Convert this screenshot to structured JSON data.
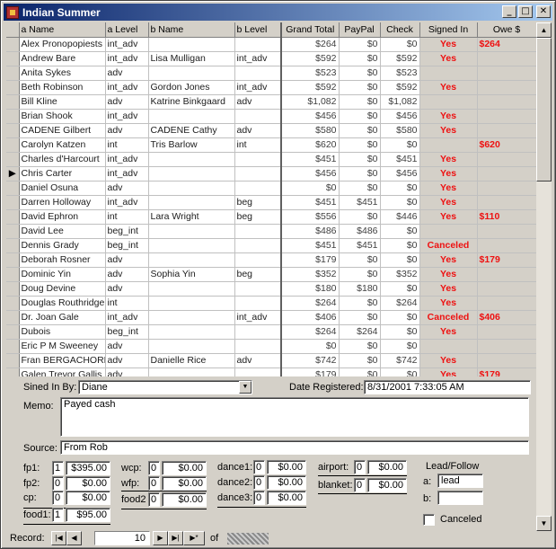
{
  "window": {
    "title": "Indian Summer"
  },
  "grid": {
    "headers": [
      "a Name",
      "a Level",
      "b Name",
      "b Level",
      "Grand Total",
      "PayPal",
      "Check",
      "Signed In",
      "Owe $"
    ],
    "rows": [
      {
        "a_name": "Alex Pronopopiests",
        "a_level": "int_adv",
        "b_name": "",
        "b_level": "",
        "grand_total": "$264",
        "paypal": "$0",
        "check": "$0",
        "signed": "Yes",
        "owe": "$264"
      },
      {
        "a_name": "Andrew Bare",
        "a_level": "int_adv",
        "b_name": "Lisa Mulligan",
        "b_level": "int_adv",
        "grand_total": "$592",
        "paypal": "$0",
        "check": "$592",
        "signed": "Yes",
        "owe": ""
      },
      {
        "a_name": "Anita Sykes",
        "a_level": "adv",
        "b_name": "",
        "b_level": "",
        "grand_total": "$523",
        "paypal": "$0",
        "check": "$523",
        "signed": "",
        "owe": ""
      },
      {
        "a_name": "Beth Robinson",
        "a_level": "int_adv",
        "b_name": "Gordon Jones",
        "b_level": "int_adv",
        "grand_total": "$592",
        "paypal": "$0",
        "check": "$592",
        "signed": "Yes",
        "owe": ""
      },
      {
        "a_name": "Bill Kline",
        "a_level": "adv",
        "b_name": "Katrine Binkgaard",
        "b_level": "adv",
        "grand_total": "$1,082",
        "paypal": "$0",
        "check": "$1,082",
        "signed": "",
        "owe": ""
      },
      {
        "a_name": "Brian Shook",
        "a_level": "int_adv",
        "b_name": "",
        "b_level": "",
        "grand_total": "$456",
        "paypal": "$0",
        "check": "$456",
        "signed": "Yes",
        "owe": ""
      },
      {
        "a_name": "CADENE Gilbert",
        "a_level": "adv",
        "b_name": "CADENE Cathy",
        "b_level": "adv",
        "grand_total": "$580",
        "paypal": "$0",
        "check": "$580",
        "signed": "Yes",
        "owe": ""
      },
      {
        "a_name": "Carolyn Katzen",
        "a_level": "int",
        "b_name": "Tris Barlow",
        "b_level": "int",
        "grand_total": "$620",
        "paypal": "$0",
        "check": "$0",
        "signed": "",
        "owe": "$620"
      },
      {
        "a_name": "Charles d'Harcourt",
        "a_level": "int_adv",
        "b_name": "",
        "b_level": "",
        "grand_total": "$451",
        "paypal": "$0",
        "check": "$451",
        "signed": "Yes",
        "owe": ""
      },
      {
        "a_name": "Chris Carter",
        "a_level": "int_adv",
        "b_name": "",
        "b_level": "",
        "grand_total": "$456",
        "paypal": "$0",
        "check": "$456",
        "signed": "Yes",
        "owe": ""
      },
      {
        "a_name": "Daniel Osuna",
        "a_level": "adv",
        "b_name": "",
        "b_level": "",
        "grand_total": "$0",
        "paypal": "$0",
        "check": "$0",
        "signed": "Yes",
        "owe": ""
      },
      {
        "a_name": "Darren Holloway",
        "a_level": "int_adv",
        "b_name": "",
        "b_level": "beg",
        "grand_total": "$451",
        "paypal": "$451",
        "check": "$0",
        "signed": "Yes",
        "owe": ""
      },
      {
        "a_name": "David Ephron",
        "a_level": "int",
        "b_name": "Lara Wright",
        "b_level": "beg",
        "grand_total": "$556",
        "paypal": "$0",
        "check": "$446",
        "signed": "Yes",
        "owe": "$110"
      },
      {
        "a_name": "David Lee",
        "a_level": "beg_int",
        "b_name": "",
        "b_level": "",
        "grand_total": "$486",
        "paypal": "$486",
        "check": "$0",
        "signed": "",
        "owe": ""
      },
      {
        "a_name": "Dennis Grady",
        "a_level": "beg_int",
        "b_name": "",
        "b_level": "",
        "grand_total": "$451",
        "paypal": "$451",
        "check": "$0",
        "signed": "Canceled",
        "owe": ""
      },
      {
        "a_name": "Deborah Rosner",
        "a_level": "adv",
        "b_name": "",
        "b_level": "",
        "grand_total": "$179",
        "paypal": "$0",
        "check": "$0",
        "signed": "Yes",
        "owe": "$179"
      },
      {
        "a_name": "Dominic Yin",
        "a_level": "adv",
        "b_name": "Sophia Yin",
        "b_level": "beg",
        "grand_total": "$352",
        "paypal": "$0",
        "check": "$352",
        "signed": "Yes",
        "owe": ""
      },
      {
        "a_name": "Doug Devine",
        "a_level": "adv",
        "b_name": "",
        "b_level": "",
        "grand_total": "$180",
        "paypal": "$180",
        "check": "$0",
        "signed": "Yes",
        "owe": ""
      },
      {
        "a_name": "Douglas Routhridge",
        "a_level": "int",
        "b_name": "",
        "b_level": "",
        "grand_total": "$264",
        "paypal": "$0",
        "check": "$264",
        "signed": "Yes",
        "owe": ""
      },
      {
        "a_name": "Dr. Joan Gale",
        "a_level": "int_adv",
        "b_name": "",
        "b_level": "int_adv",
        "grand_total": "$406",
        "paypal": "$0",
        "check": "$0",
        "signed": "Canceled",
        "owe": "$406"
      },
      {
        "a_name": "Dubois",
        "a_level": "beg_int",
        "b_name": "",
        "b_level": "",
        "grand_total": "$264",
        "paypal": "$264",
        "check": "$0",
        "signed": "Yes",
        "owe": ""
      },
      {
        "a_name": "Eric P M Sweeney",
        "a_level": "adv",
        "b_name": "",
        "b_level": "",
        "grand_total": "$0",
        "paypal": "$0",
        "check": "$0",
        "signed": "",
        "owe": ""
      },
      {
        "a_name": "Fran BERGACHORE",
        "a_level": "adv",
        "b_name": "Danielle Rice",
        "b_level": "adv",
        "grand_total": "$742",
        "paypal": "$0",
        "check": "$742",
        "signed": "Yes",
        "owe": ""
      },
      {
        "a_name": "Galen Trevor Gallis",
        "a_level": "adv",
        "b_name": "",
        "b_level": "",
        "grand_total": "$179",
        "paypal": "$0",
        "check": "$0",
        "signed": "Yes",
        "owe": "$179"
      }
    ],
    "current_row_index": 9
  },
  "form": {
    "signed_in_by_label": "Sined In By:",
    "signed_in_by_value": "Diane",
    "date_registered_label": "Date Registered:",
    "date_registered_value": "8/31/2001 7:33:05 AM",
    "memo_label": "Memo:",
    "memo_value": "Payed cash",
    "source_label": "Source:",
    "source_value": "From Rob",
    "fees": {
      "fp1": {
        "label": "fp1:",
        "qty": "1",
        "amount": "$395.00"
      },
      "fp2": {
        "label": "fp2:",
        "qty": "0",
        "amount": "$0.00"
      },
      "cp": {
        "label": "cp:",
        "qty": "0",
        "amount": "$0.00"
      },
      "food1": {
        "label": "food1:",
        "qty": "1",
        "amount": "$95.00"
      },
      "wcp": {
        "label": "wcp:",
        "qty": "0",
        "amount": "$0.00"
      },
      "wfp": {
        "label": "wfp:",
        "qty": "0",
        "amount": "$0.00"
      },
      "food2": {
        "label": "food2",
        "qty": "0",
        "amount": "$0.00"
      },
      "dance1": {
        "label": "dance1:",
        "qty": "0",
        "amount": "$0.00"
      },
      "dance2": {
        "label": "dance2:",
        "qty": "0",
        "amount": "$0.00"
      },
      "dance3": {
        "label": "dance3:",
        "qty": "0",
        "amount": "$0.00"
      },
      "airport": {
        "label": "airport:",
        "qty": "0",
        "amount": "$0.00"
      },
      "blanket": {
        "label": "blanket:",
        "qty": "0",
        "amount": "$0.00"
      }
    },
    "lead_follow": {
      "title": "Lead/Follow",
      "a_label": "a:",
      "a_value": "lead",
      "b_label": "b:",
      "b_value": ""
    },
    "canceled_label": "Canceled",
    "canceled_checked": false
  },
  "nav": {
    "record_label": "Record:",
    "current_record": "10",
    "of_label": "of"
  }
}
